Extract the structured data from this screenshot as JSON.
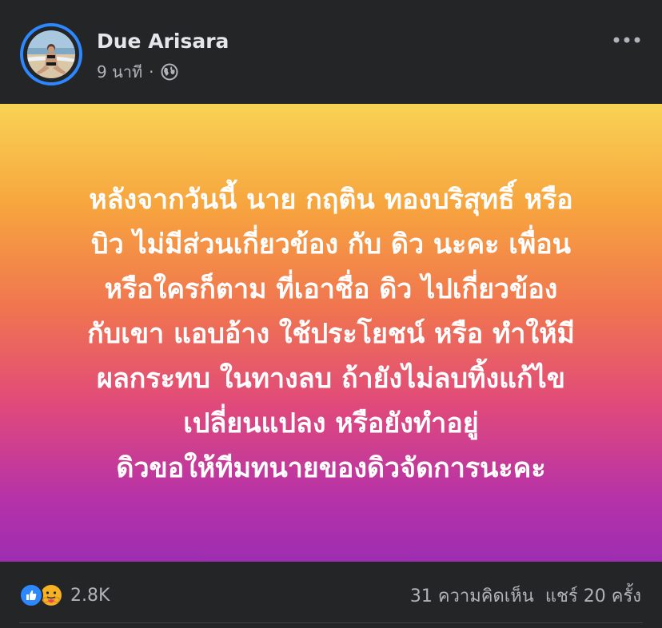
{
  "post": {
    "author": "Due Arisara",
    "timestamp": "9 นาที",
    "separator": "·",
    "privacy_icon": "globe-icon",
    "menu_icon": "more-horizontal-icon",
    "background_gradient": [
      "#f8d354",
      "#f7a53e",
      "#f07450",
      "#e0497b",
      "#b632a8",
      "#9e2db2"
    ],
    "text": "หลังจากวันนี้ นาย กฤติน ทองบริสุทธิ์ หรือ\nบิว ไม่มีส่วนเกี่ยวข้อง กับ ดิว นะคะ เพื่อน\nหรือใครก็ตาม ที่เอาชื่อ ดิว ไปเกี่ยวข้อง\nกับเขา แอบอ้าง ใช้ประโยชน์ หรือ ทำให้มี\nผลกระทบ ในทางลบ ถ้ายังไม่ลบทิ้งแก้ไข\nเปลี่ยนแปลง หรือยังทำอยู่\nดิวขอให้ทีมทนายของดิวจัดการนะคะ"
  },
  "footer": {
    "reaction_icons": [
      "like-icon",
      "care-icon"
    ],
    "reaction_count": "2.8K",
    "comments": "31 ความคิดเห็น",
    "shares": "แชร์ 20 ครั้ง"
  },
  "colors": {
    "background": "#242526",
    "accent": "#2d88ff",
    "primary_text": "#e4e6eb",
    "secondary_text": "#b0b3b8"
  }
}
